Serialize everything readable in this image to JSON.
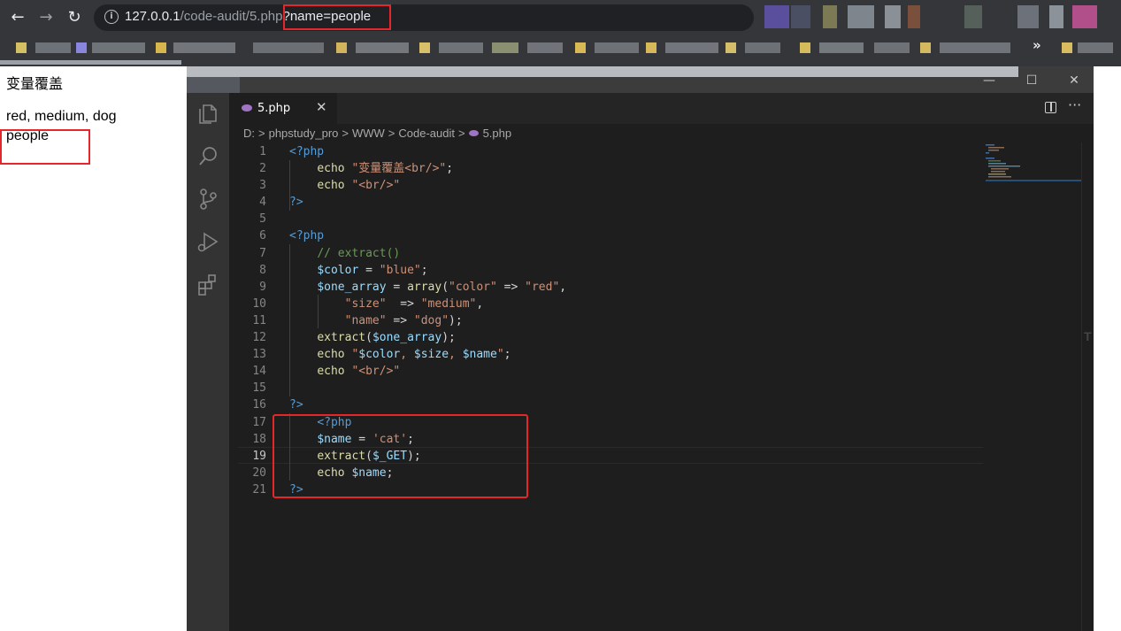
{
  "browser": {
    "url_host": "127.0.0.1",
    "url_path": "/code-audit/5.php",
    "url_query": "?name=people",
    "overflow_bookmarks_label": "»"
  },
  "page": {
    "line1": "变量覆盖",
    "line2": "red, medium, dog",
    "line3": "people"
  },
  "vscode": {
    "tab_label": "5.php",
    "tab_close": "✕",
    "more_actions": "···",
    "breadcrumb": [
      "D:",
      "phpstudy_pro",
      "WWW",
      "Code-audit",
      "5.php"
    ],
    "window_buttons": {
      "minimize": "—",
      "maximize": "☐",
      "close": "✕"
    },
    "active_line": 19,
    "line_numbers": [
      "1",
      "2",
      "3",
      "4",
      "5",
      "6",
      "7",
      "8",
      "9",
      "10",
      "11",
      "12",
      "13",
      "14",
      "15",
      "16",
      "17",
      "18",
      "19",
      "20",
      "21"
    ],
    "code_lines": [
      "<?php",
      "    echo \"变量覆盖<br/>\";",
      "    echo \"<br/>\"",
      "?>",
      "",
      "<?php",
      "    // extract()",
      "    $color = \"blue\";",
      "    $one_array = array(\"color\" => \"red\",",
      "        \"size\"  => \"medium\",",
      "        \"name\" => \"dog\");",
      "    extract($one_array);",
      "    echo \"$color, $size, $name\";",
      "    echo \"<br/>\"",
      "",
      "?>",
      "    <?php",
      "    $name = 'cat';",
      "    extract($_GET);",
      "    echo $name;",
      "?>"
    ]
  },
  "colors": {
    "highlight_box": "#e5262b",
    "editor_bg": "#1e1e1e",
    "keyword": "#569cd6",
    "string": "#ce9178",
    "variable": "#9cdcfe",
    "function": "#dcdcaa",
    "comment": "#6a9955"
  }
}
